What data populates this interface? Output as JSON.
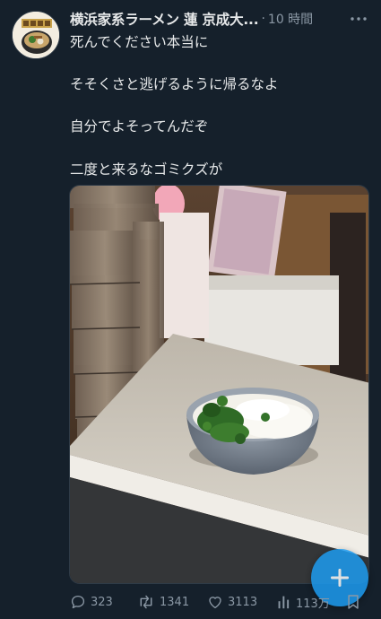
{
  "tweet": {
    "author_name": "横浜家系ラーメン 蓮 京成大...",
    "separator": "·",
    "time": "10 時間",
    "lines": [
      "死んでください本当に",
      "",
      "そそくさと逃げるように帰るなよ",
      "",
      "自分でよそってんだぞ",
      "",
      "二度と来るなゴミクズが"
    ]
  },
  "actions": {
    "reply_count": "323",
    "retweet_count": "1341",
    "like_count": "3113",
    "views_count": "113万"
  },
  "icons": {
    "more": "more-dots-icon",
    "reply": "reply-icon",
    "retweet": "retweet-icon",
    "like": "heart-icon",
    "views": "views-chart-icon",
    "bookmark": "bookmark-icon",
    "compose": "plus-icon"
  },
  "colors": {
    "background": "#15202b",
    "text": "#e7e9ea",
    "secondary": "#8b98a5",
    "accent": "#1d9bf0"
  }
}
